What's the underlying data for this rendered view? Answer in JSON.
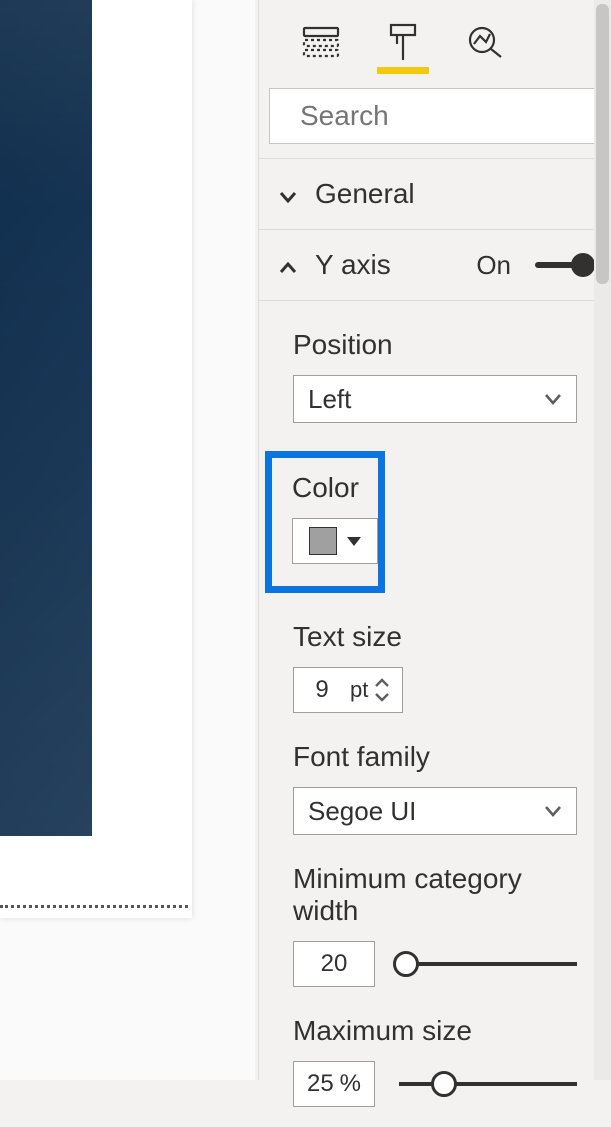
{
  "pane_tabs": {
    "fields_name": "fields-icon",
    "format_name": "format-icon",
    "analytics_name": "analytics-icon"
  },
  "search": {
    "placeholder": "Search"
  },
  "sections": {
    "general": {
      "title": "General"
    },
    "y_axis": {
      "title": "Y axis",
      "toggle_label": "On",
      "toggle_on": true
    }
  },
  "y_axis_props": {
    "position": {
      "label": "Position",
      "value": "Left"
    },
    "color": {
      "label": "Color",
      "swatch": "#a0a0a0"
    },
    "text_size": {
      "label": "Text size",
      "value": "9",
      "unit": "pt"
    },
    "font_family": {
      "label": "Font family",
      "value": "Segoe UI"
    },
    "min_cat_width": {
      "label": "Minimum category width",
      "value": "20",
      "slider_pct": 4
    },
    "max_size": {
      "label": "Maximum size",
      "value": "25",
      "unit": "%",
      "slider_pct": 25
    }
  }
}
